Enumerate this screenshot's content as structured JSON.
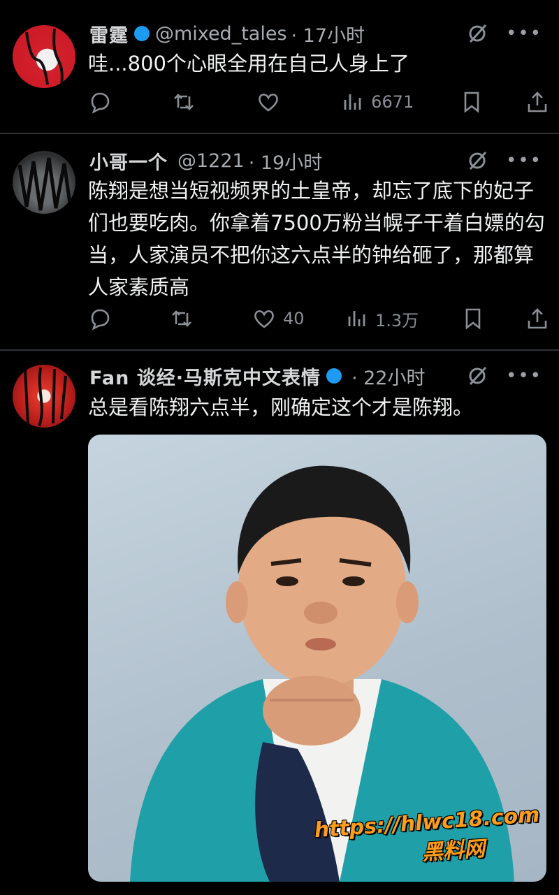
{
  "posts": [
    {
      "name": "雷霆",
      "handle": "@mixed_tales",
      "time": "· 17小时",
      "text": "哇...800个心眼全用在自己人身上了",
      "actions": {
        "reply": "",
        "repost": "",
        "like": "",
        "views": "6671"
      }
    },
    {
      "name": "小哥一个",
      "handle": "@1221",
      "time": "· 19小时",
      "text": "陈翔是想当短视频界的土皇帝，却忘了底下的妃子们也要吃肉。你拿着7500万粉当幌子干着白嫖的勾当，人家演员不把你这六点半的钟给砸了，那都算人家素质高",
      "actions": {
        "reply": "",
        "repost": "",
        "like": "40",
        "views": "1.3万"
      }
    },
    {
      "name": "Fan 谈经·马斯克中文表情",
      "handle": "",
      "time": "· 22小时",
      "text": "总是看陈翔六点半，刚确定这个才是陈翔。",
      "actions": {
        "reply": "",
        "repost": "",
        "like": "",
        "views": ""
      }
    }
  ],
  "watermark": {
    "url": "https://hlwc18.com",
    "cn": "黑料网"
  },
  "colors": {
    "background": "#000000",
    "text": "#e7e9ea",
    "muted": "#8b9096",
    "verified": "#1d9bf0",
    "watermark": "#ff9d1a"
  }
}
